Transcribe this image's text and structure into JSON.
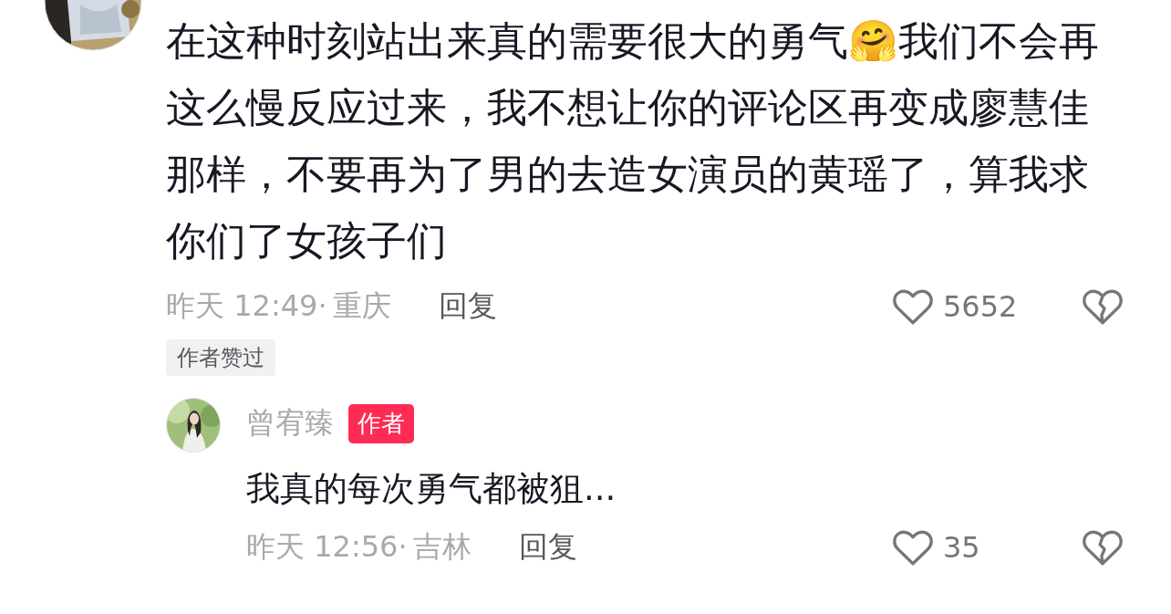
{
  "comment": {
    "text": "在这种时刻站出来真的需要很大的勇气🤗我们不会再这么慢反应过来，我不想让你的评论区再变成廖慧佳那样，不要再为了男的去造女演员的黄瑶了，算我求你们了女孩子们",
    "time": "昨天 12:49·",
    "location": "重庆",
    "reply_label": "回复",
    "likes": "5652",
    "author_liked": "作者赞过"
  },
  "reply": {
    "username": "曾宥臻",
    "author_badge": "作者",
    "text": "我真的每次勇气都被狙...",
    "time": "昨天 12:56·",
    "location": "吉林",
    "reply_label": "回复",
    "likes": "35"
  }
}
